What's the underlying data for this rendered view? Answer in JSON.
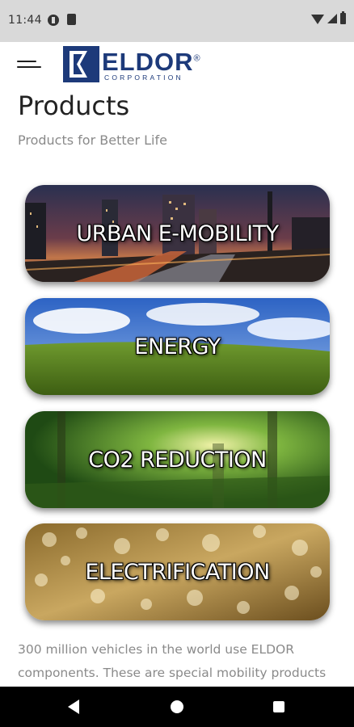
{
  "status_bar": {
    "time": "11:44",
    "icons": [
      "data-saver-icon",
      "sim-card-icon",
      "wifi-icon",
      "signal-icon",
      "battery-icon"
    ]
  },
  "header": {
    "menu_icon": "hamburger-menu-icon",
    "logo": {
      "wordmark": "ELDOR",
      "registered": "®",
      "subtitle": "CORPORATION",
      "color": "#1d3a7a"
    }
  },
  "page": {
    "title": "Products",
    "subtitle": "Products for Better Life"
  },
  "categories": [
    {
      "label": "URBAN E-MOBILITY"
    },
    {
      "label": "ENERGY"
    },
    {
      "label": "CO2 REDUCTION"
    },
    {
      "label": "ELECTRIFICATION"
    }
  ],
  "intro_text": "300 million vehicles in the world use ELDOR components. These are special mobility products",
  "nav_bar": {
    "icons": [
      "back-icon",
      "home-icon",
      "recent-apps-icon"
    ]
  }
}
